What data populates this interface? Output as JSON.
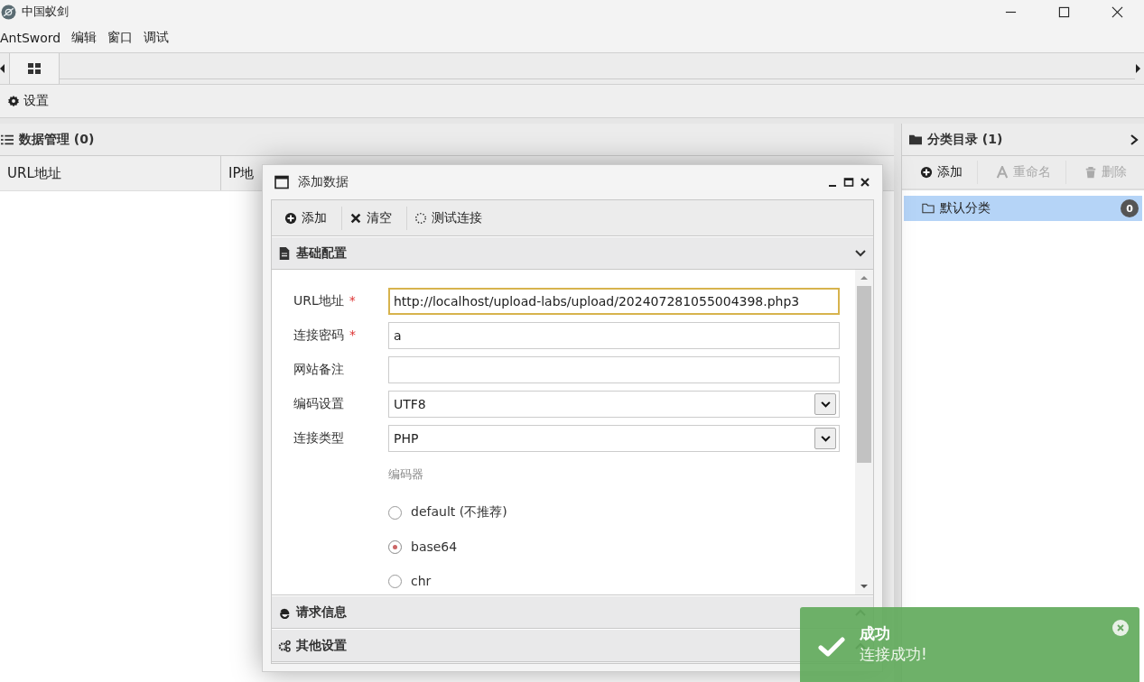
{
  "window": {
    "title": "中国蚁剑"
  },
  "menu": [
    "AntSword",
    "编辑",
    "窗口",
    "调试"
  ],
  "toolbar": {
    "label": "设置"
  },
  "data_panel": {
    "title": "数据管理 (0)",
    "columns": [
      "URL地址",
      "IP地"
    ]
  },
  "category_panel": {
    "title": "分类目录 (1)",
    "actions": [
      {
        "label": "添加",
        "disabled": false
      },
      {
        "label": "重命名",
        "disabled": true
      },
      {
        "label": "删除",
        "disabled": true
      }
    ],
    "items": [
      {
        "label": "默认分类",
        "count": "0",
        "selected": true
      }
    ]
  },
  "dialog": {
    "title": "添加数据",
    "actions": [
      "添加",
      "清空",
      "测试连接"
    ],
    "sections": [
      {
        "title": "基础配置",
        "expanded": true
      },
      {
        "title": "请求信息",
        "expanded": false
      },
      {
        "title": "其他设置",
        "expanded": false
      }
    ],
    "fields": [
      {
        "label": "URL地址",
        "required_mark": "*",
        "kind": "input",
        "value": "http://localhost/upload-labs/upload/202407281055004398.php3",
        "focused": true
      },
      {
        "label": "连接密码",
        "required_mark": "*",
        "kind": "input",
        "value": "a",
        "focused": false
      },
      {
        "label": "网站备注",
        "kind": "input",
        "focused": false
      },
      {
        "label": "编码设置",
        "kind": "select",
        "value": "UTF8",
        "focused": false
      },
      {
        "label": "连接类型",
        "kind": "select",
        "value": "PHP",
        "focused": false
      }
    ],
    "encoder": {
      "label": "编码器",
      "options": [
        {
          "label": "default (不推荐)",
          "selected": false
        },
        {
          "label": "base64",
          "selected": true
        },
        {
          "label": "chr",
          "selected": false
        }
      ]
    }
  },
  "toast": {
    "title": "成功",
    "message": "连接成功!"
  }
}
